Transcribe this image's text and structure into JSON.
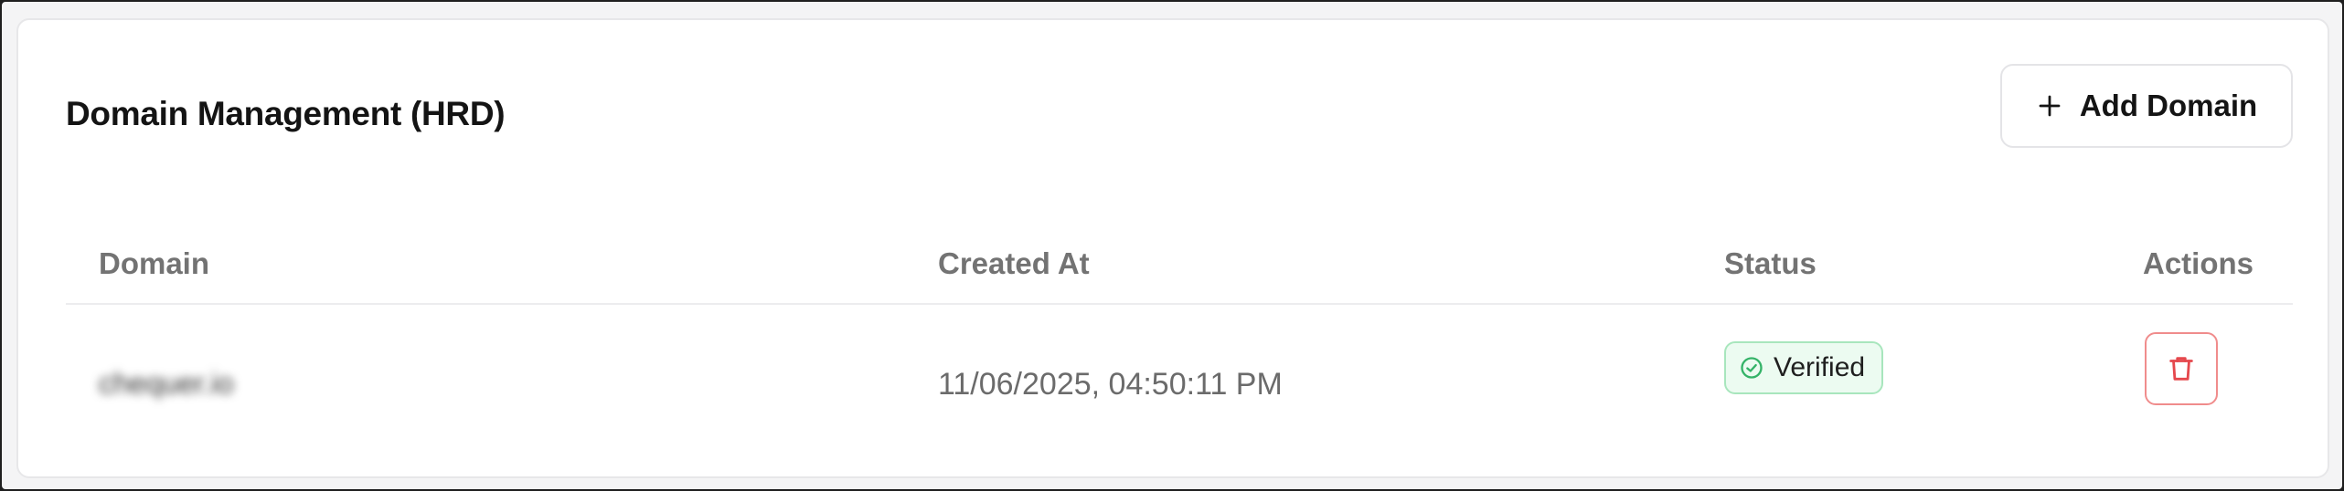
{
  "card": {
    "title": "Domain Management (HRD)",
    "add_button_label": "Add Domain"
  },
  "table": {
    "columns": [
      "Domain",
      "Created At",
      "Status",
      "Actions"
    ],
    "rows": [
      {
        "domain": "chequer.io",
        "created_at": "11/06/2025, 04:50:11 PM",
        "status": "Verified"
      }
    ]
  },
  "icons": {
    "add": "plus-icon",
    "status": "check-circle-icon",
    "delete": "trash-icon"
  },
  "colors": {
    "status_verified_bg": "#ecfbf1",
    "status_verified_border": "#a8e6bd",
    "status_verified_icon": "#34b368",
    "delete_accent": "#e5484d"
  }
}
